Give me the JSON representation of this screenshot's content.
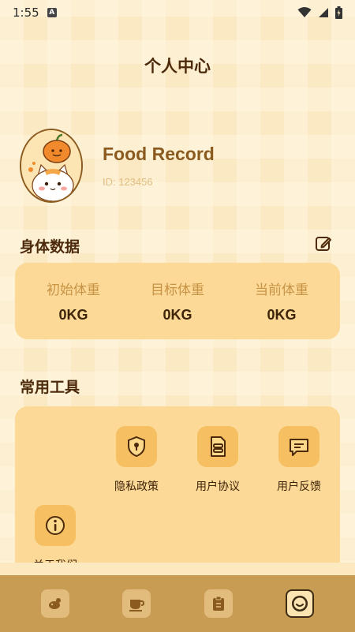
{
  "status_bar": {
    "time": "1:55",
    "notif_glyph": "A"
  },
  "header": {
    "title": "个人中心"
  },
  "profile": {
    "name": "Food Record",
    "id_text": "ID: 123456"
  },
  "body_data": {
    "title": "身体数据",
    "stats": [
      {
        "label": "初始体重",
        "value": "0KG"
      },
      {
        "label": "目标体重",
        "value": "0KG"
      },
      {
        "label": "当前体重",
        "value": "0KG"
      }
    ]
  },
  "tools": {
    "title": "常用工具",
    "items": [
      {
        "label": "隐私政策",
        "icon": "shield-lock-icon"
      },
      {
        "label": "用户协议",
        "icon": "document-icon"
      },
      {
        "label": "用户反馈",
        "icon": "message-icon"
      },
      {
        "label": "关于我们",
        "icon": "info-icon"
      }
    ]
  },
  "tab_bar": {
    "items": [
      {
        "icon": "food-icon",
        "active": false
      },
      {
        "icon": "cup-icon",
        "active": false
      },
      {
        "icon": "clipboard-icon",
        "active": false
      },
      {
        "icon": "profile-face-icon",
        "active": true
      }
    ]
  },
  "colors": {
    "background": "#fbe9c4",
    "card": "#fcd997",
    "accent": "#f5bf62",
    "tab_bar": "#c99c54",
    "title_text": "#4d2a0c",
    "muted_text": "#c79345"
  }
}
